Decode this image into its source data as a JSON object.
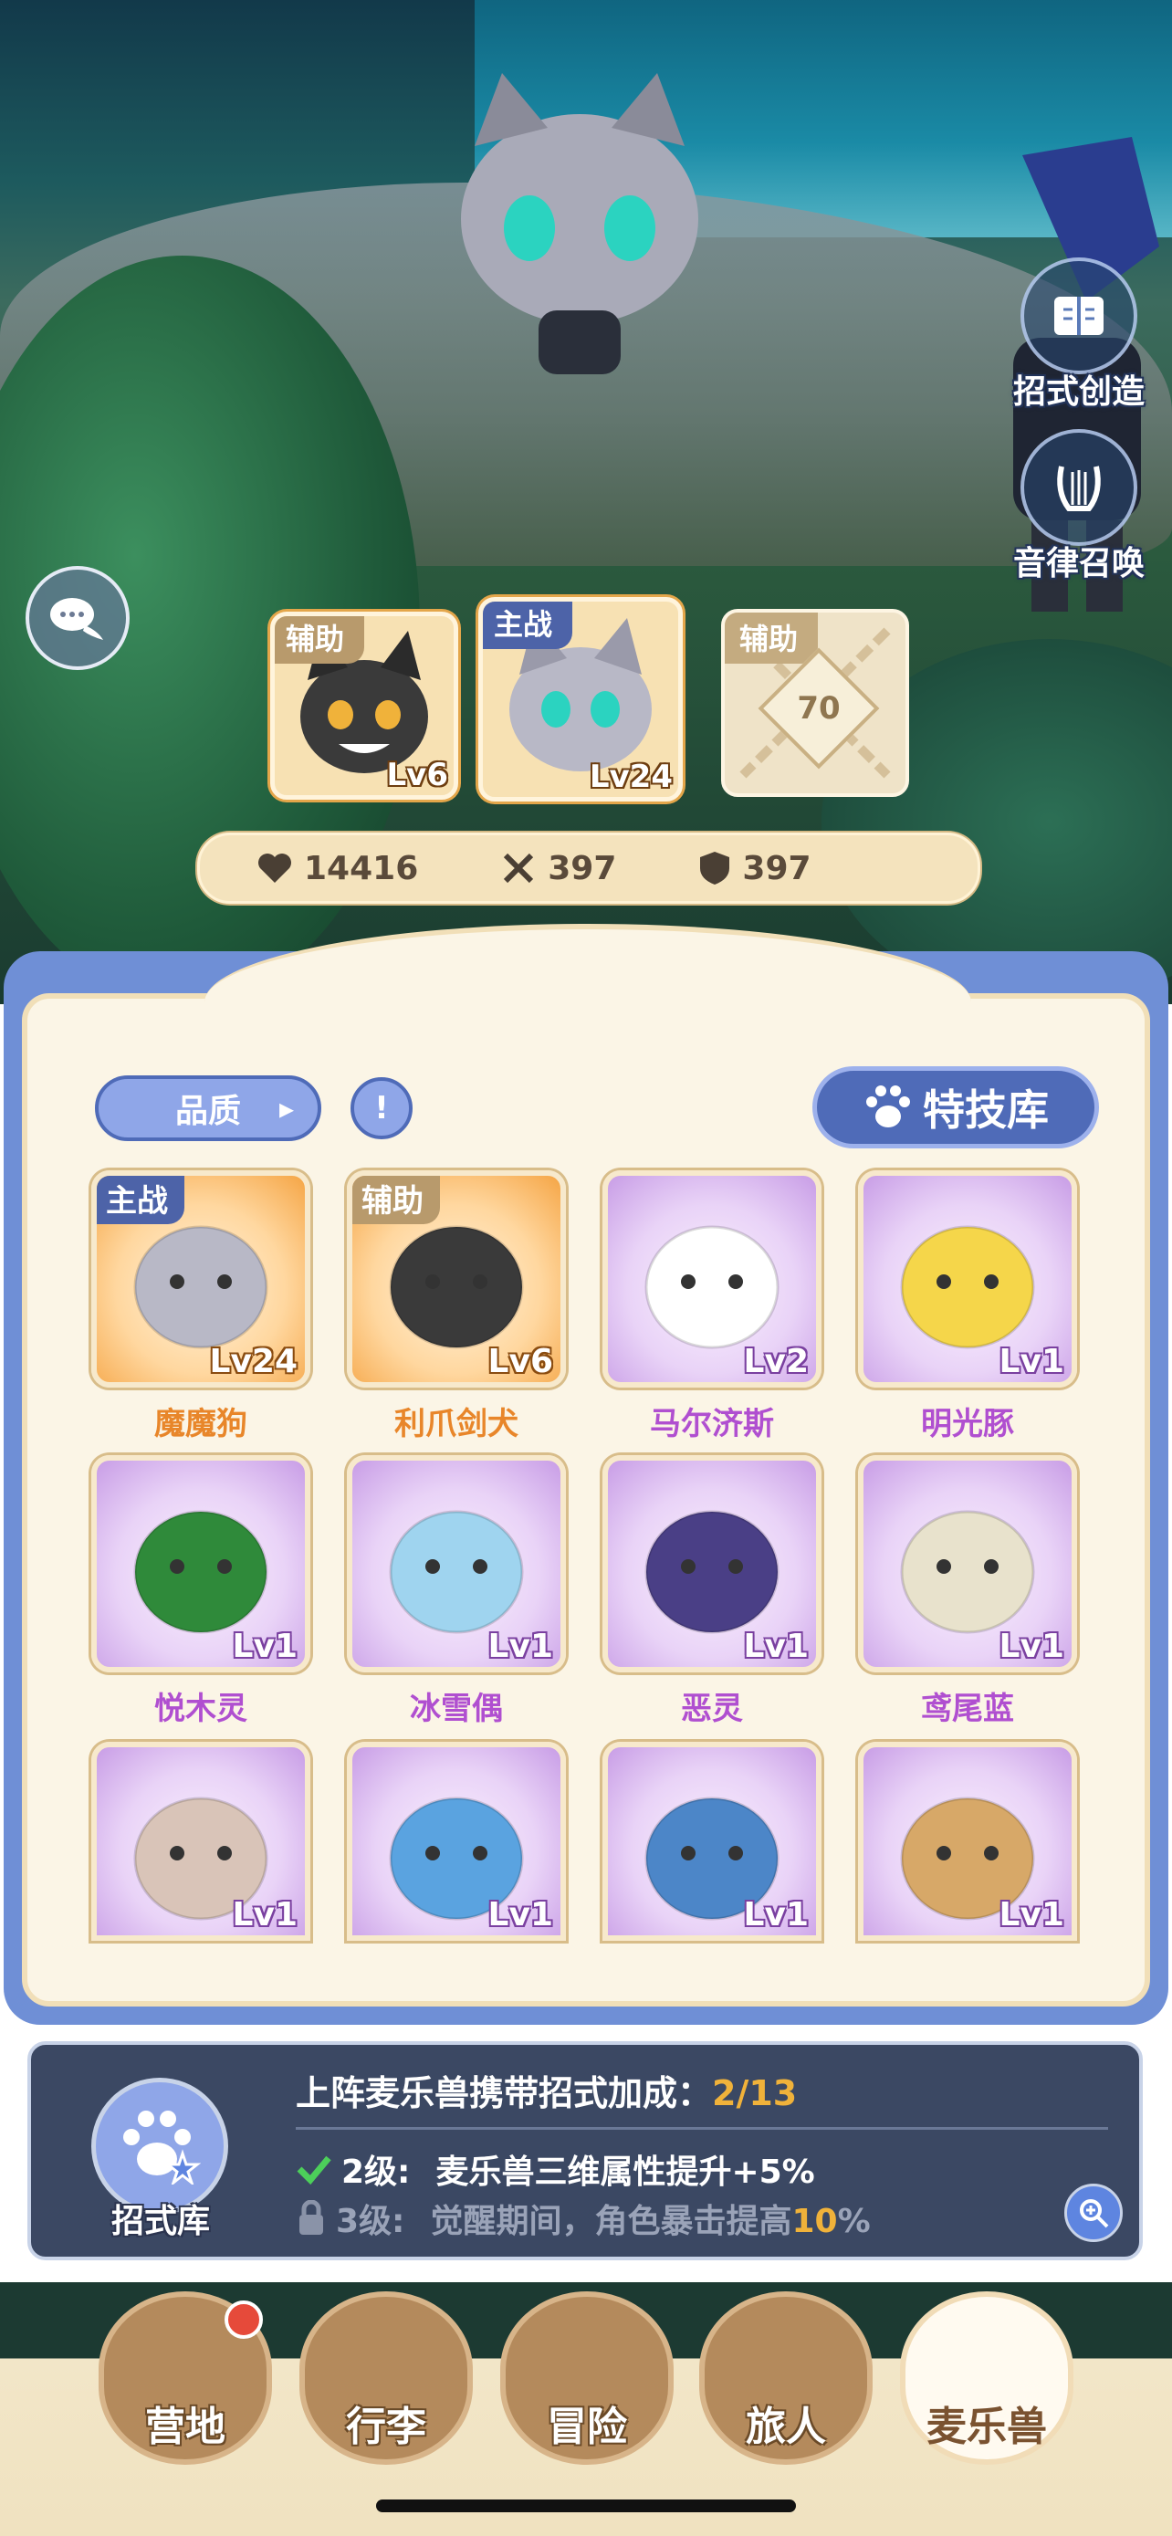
{
  "side_buttons": {
    "create_move": "招式创造",
    "melody_summon": "音律召唤"
  },
  "team": {
    "slot_left": {
      "role": "辅助",
      "level": "Lv6"
    },
    "slot_main": {
      "role": "主战",
      "level": "Lv24"
    },
    "slot_locked": {
      "role": "辅助",
      "unlock_level": "70"
    }
  },
  "stats": {
    "hp": "14416",
    "attack": "397",
    "defense": "397"
  },
  "toolbar": {
    "quality_label": "品质",
    "quality_arrow": "▸",
    "info_icon": "!",
    "skill_library_label": "特技库"
  },
  "pets": [
    {
      "name": "魔魔狗",
      "level": "Lv24",
      "tag": "主战",
      "frame": "orange",
      "color": "#b8b8c6"
    },
    {
      "name": "利爪剑犬",
      "level": "Lv6",
      "tag": "辅助",
      "frame": "orange",
      "color": "#3a3a3a"
    },
    {
      "name": "马尔济斯",
      "level": "Lv2",
      "tag": "",
      "frame": "purple",
      "color": "#ffffff"
    },
    {
      "name": "明光豚",
      "level": "Lv1",
      "tag": "",
      "frame": "purple",
      "color": "#f5d64a"
    },
    {
      "name": "悦木灵",
      "level": "Lv1",
      "tag": "",
      "frame": "purple",
      "color": "#2f8a3a"
    },
    {
      "name": "冰雪偶",
      "level": "Lv1",
      "tag": "",
      "frame": "purple",
      "color": "#9fd4ef"
    },
    {
      "name": "恶灵",
      "level": "Lv1",
      "tag": "",
      "frame": "purple",
      "color": "#4a3f86"
    },
    {
      "name": "鸢尾蓝",
      "level": "Lv1",
      "tag": "",
      "frame": "purple",
      "color": "#e8e2cc"
    },
    {
      "name": "",
      "level": "Lv1",
      "tag": "",
      "frame": "purple",
      "color": "#d9c4b8"
    },
    {
      "name": "",
      "level": "Lv1",
      "tag": "",
      "frame": "purple",
      "color": "#5aa3e0"
    },
    {
      "name": "",
      "level": "Lv1",
      "tag": "",
      "frame": "purple",
      "color": "#4c86c8"
    },
    {
      "name": "",
      "level": "Lv1",
      "tag": "",
      "frame": "purple",
      "color": "#d7a868"
    }
  ],
  "bonus": {
    "title": "上阵麦乐兽携带招式加成：",
    "progress": "2/13",
    "level2_label": "2级:",
    "level2_text": "麦乐兽三维属性提升+5%",
    "level3_label": "3级:",
    "level3_text_a": "觉醒期间，角色暴击提高",
    "level3_highlight": "10",
    "level3_text_b": "%",
    "skill_library_button": "招式库"
  },
  "nav": {
    "camp": "营地",
    "luggage": "行李",
    "adventure": "冒险",
    "traveler": "旅人",
    "melody_beast": "麦乐兽"
  },
  "colors": {
    "main_tag": "#4d63a8",
    "support_tag": "#b89a6c",
    "name_orange": "#e8862a",
    "name_purple": "#b04fd0",
    "accent_gold": "#f0b23a",
    "check_green": "#4ccf5a"
  }
}
